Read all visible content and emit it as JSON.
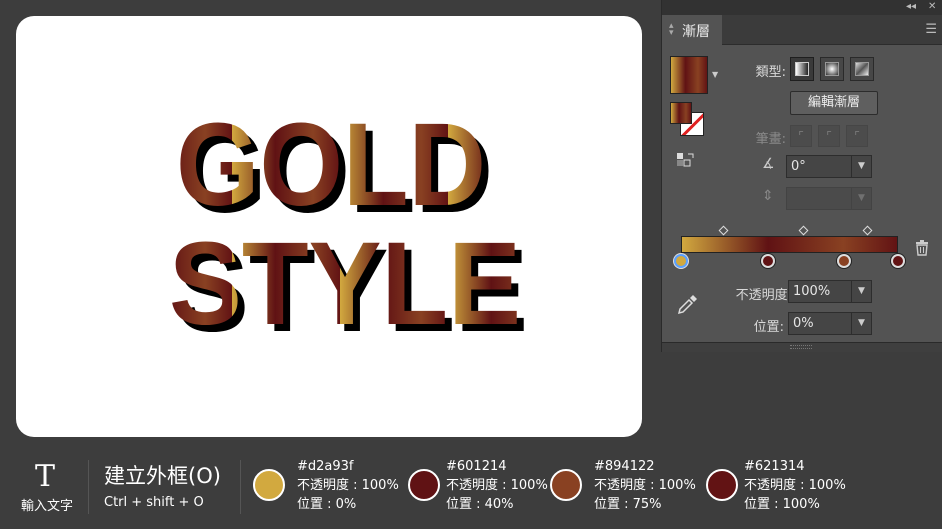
{
  "artwork": {
    "line1": "GOLD",
    "line2": "STYLE",
    "gradient_colors": [
      "#d2a93f",
      "#601214",
      "#894122",
      "#621314"
    ],
    "shadow_color": "#000000"
  },
  "panel": {
    "tab_label": "漸層",
    "type_label": "類型:",
    "edit_gradient_label": "編輯漸層",
    "stroke_label": "筆畫:",
    "angle_value": "0°",
    "opacity_label": "不透明度:",
    "opacity_value": "100%",
    "location_label": "位置:",
    "location_value": "0%",
    "stops": [
      {
        "color": "#d2a93f",
        "position": 0
      },
      {
        "color": "#601214",
        "position": 40
      },
      {
        "color": "#894122",
        "position": 75
      },
      {
        "color": "#621314",
        "position": 100
      }
    ]
  },
  "legend": {
    "tool_icon": "T",
    "tool_label": "輸入文字",
    "shortcut_title": "建立外框(O)",
    "shortcut_keys": "Ctrl + shift + O",
    "items": [
      {
        "hex": "#d2a93f",
        "opacity": "不透明度 : 100%",
        "location": "位置 : 0%"
      },
      {
        "hex": "#601214",
        "opacity": "不透明度 : 100%",
        "location": "位置 : 40%"
      },
      {
        "hex": "#894122",
        "opacity": "不透明度 : 100%",
        "location": "位置 : 75%"
      },
      {
        "hex": "#621314",
        "opacity": "不透明度 : 100%",
        "location": "位置 : 100%"
      }
    ]
  }
}
